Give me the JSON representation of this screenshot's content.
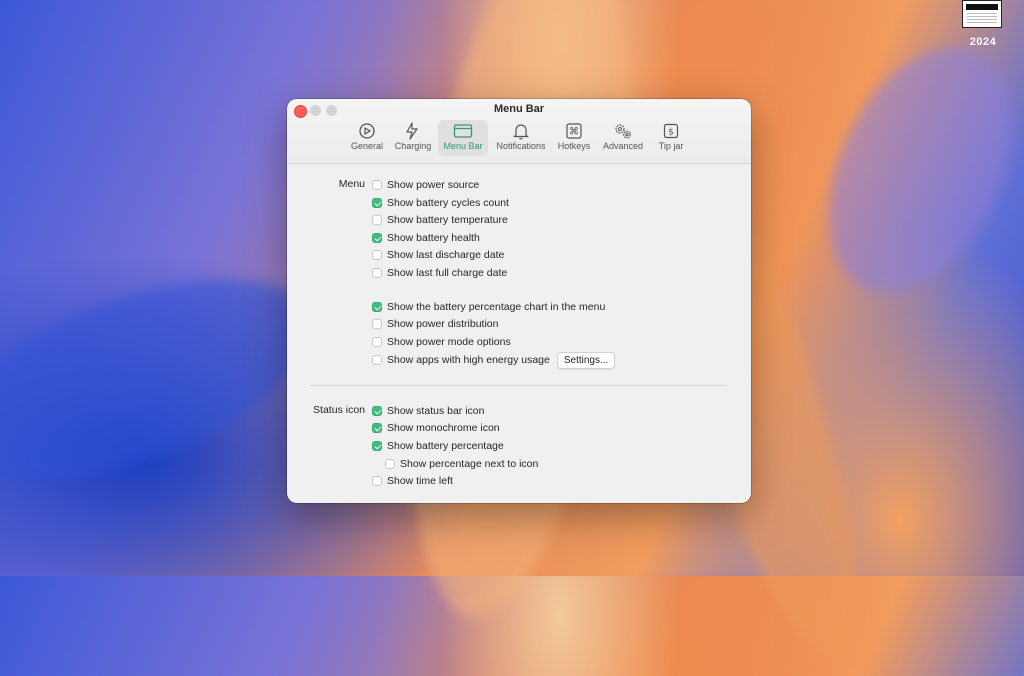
{
  "desktop": {
    "year_label": "2024"
  },
  "window": {
    "title": "Menu Bar",
    "tabs": [
      {
        "label": "General",
        "icon": "gauge-icon",
        "active": false
      },
      {
        "label": "Charging",
        "icon": "bolt-icon",
        "active": false
      },
      {
        "label": "Menu Bar",
        "icon": "menubar-icon",
        "active": true
      },
      {
        "label": "Notifications",
        "icon": "bell-icon",
        "active": false
      },
      {
        "label": "Hotkeys",
        "icon": "command-key-icon",
        "active": false
      },
      {
        "label": "Advanced",
        "icon": "gears-icon",
        "active": false
      },
      {
        "label": "Tip jar",
        "icon": "dollar-icon",
        "active": false
      }
    ]
  },
  "menu_section": {
    "label": "Menu",
    "options": [
      {
        "label": "Show power source",
        "checked": false
      },
      {
        "label": "Show battery cycles count",
        "checked": true
      },
      {
        "label": "Show battery temperature",
        "checked": false
      },
      {
        "label": "Show battery health",
        "checked": true
      },
      {
        "label": "Show last discharge date",
        "checked": false
      },
      {
        "label": "Show last full charge date",
        "checked": false
      },
      {
        "label": "Show the battery percentage chart in the menu",
        "checked": true
      },
      {
        "label": "Show power distribution",
        "checked": false
      },
      {
        "label": "Show power mode options",
        "checked": false
      },
      {
        "label": "Show apps with high energy usage",
        "checked": false
      }
    ],
    "settings_button": "Settings..."
  },
  "status_section": {
    "label": "Status icon",
    "options": [
      {
        "label": "Show status bar icon",
        "checked": true
      },
      {
        "label": "Show monochrome icon",
        "checked": true
      },
      {
        "label": "Show battery percentage",
        "checked": true
      },
      {
        "label": "Show percentage next to icon",
        "checked": false
      },
      {
        "label": "Show time left",
        "checked": false
      }
    ]
  },
  "colors": {
    "accent": "#3ebd7e",
    "active_tab_text": "#2f9a6b",
    "close": "#ff5f57"
  }
}
